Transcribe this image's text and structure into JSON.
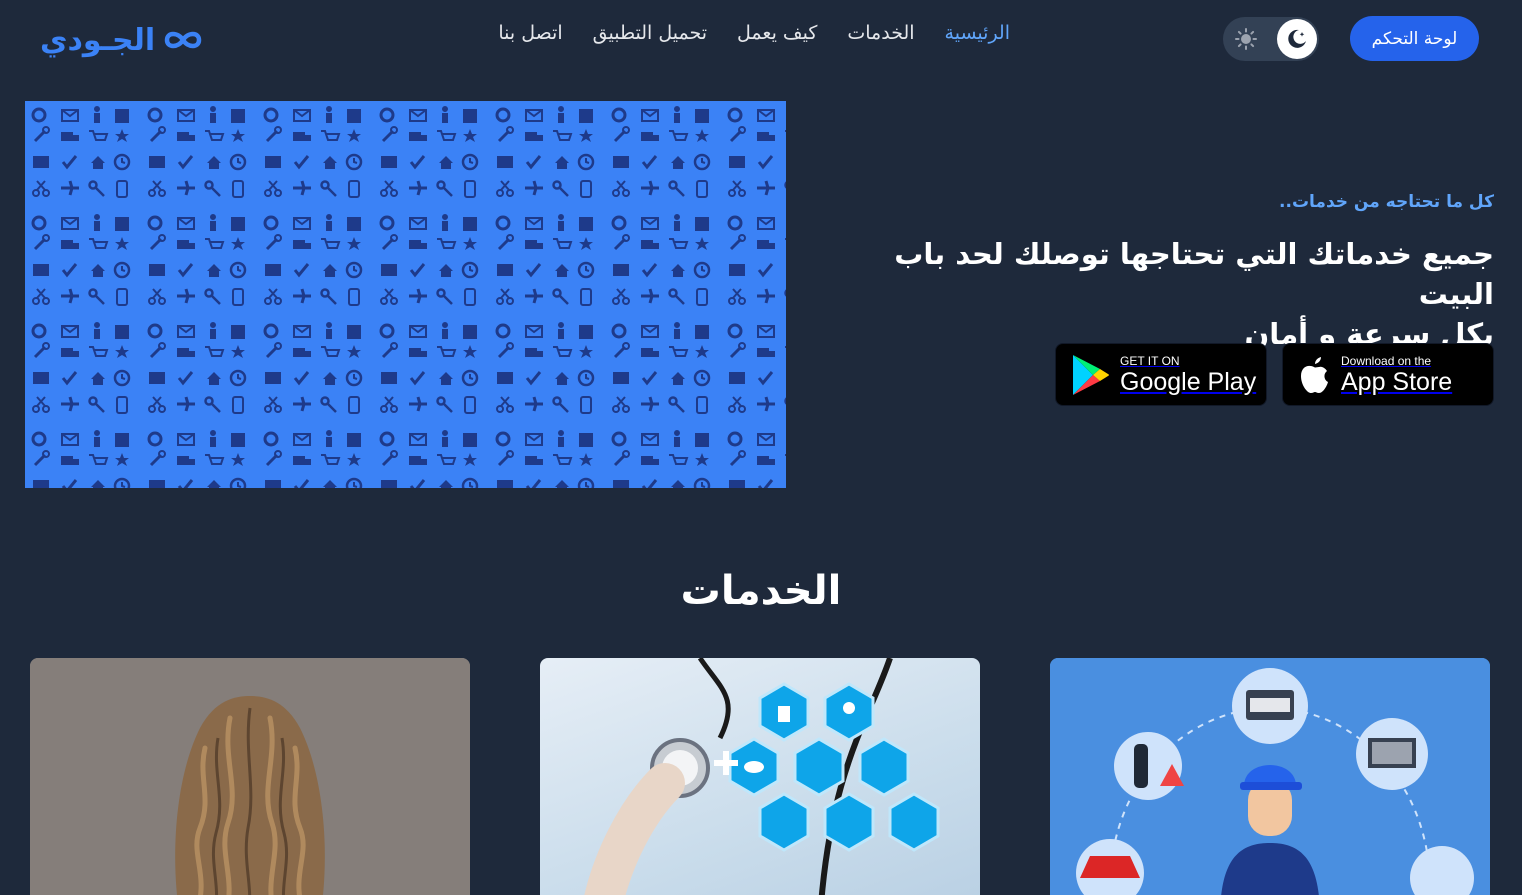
{
  "header": {
    "logo_text": "الجـودي",
    "nav": [
      {
        "label": "الرئيسية",
        "active": true
      },
      {
        "label": "الخدمات",
        "active": false
      },
      {
        "label": "كيف يعمل",
        "active": false
      },
      {
        "label": "تحميل التطبيق",
        "active": false
      },
      {
        "label": "اتصل بنا",
        "active": false
      }
    ],
    "dashboard_label": "لوحة التحكم",
    "theme_icons": {
      "light": "sun-icon",
      "dark": "moon-icon"
    }
  },
  "hero": {
    "subtitle": "كل ما تحتاجه من خدمات..",
    "title_line1": "جميع خدماتك التي تحتاجها توصلك لحد باب البيت",
    "title_line2": "بكل سرعة و أمان",
    "google_play": {
      "small": "GET IT ON",
      "big": "Google Play"
    },
    "app_store": {
      "small": "Download on the",
      "big": "App Store"
    }
  },
  "services": {
    "title": "الخدمات",
    "cards": [
      {
        "image": "hair-care-image"
      },
      {
        "image": "medical-stethoscope-image"
      },
      {
        "image": "car-mechanic-image"
      }
    ]
  },
  "colors": {
    "background": "#1e293b",
    "accent": "#2563eb",
    "link_active": "#60a5fa",
    "hero_pattern": "#3b82f6",
    "pattern_icons": "#1e3a8a"
  }
}
